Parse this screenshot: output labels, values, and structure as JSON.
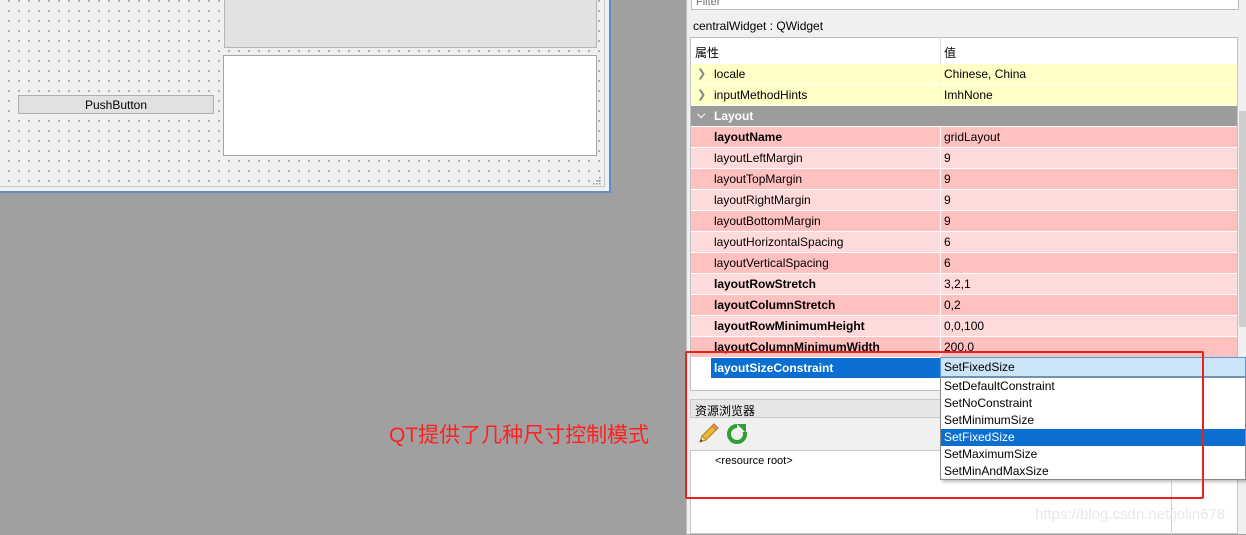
{
  "form": {
    "push_button_label": "PushButton"
  },
  "property_editor": {
    "filter_placeholder": "Filter",
    "object_label": "centralWidget : QWidget",
    "header": {
      "property": "属性",
      "value": "值"
    },
    "rows": [
      {
        "name": "locale",
        "value": "Chinese, China"
      },
      {
        "name": "inputMethodHints",
        "value": "ImhNone"
      },
      {
        "name": "Layout",
        "value": ""
      },
      {
        "name": "layoutName",
        "value": "gridLayout"
      },
      {
        "name": "layoutLeftMargin",
        "value": "9"
      },
      {
        "name": "layoutTopMargin",
        "value": "9"
      },
      {
        "name": "layoutRightMargin",
        "value": "9"
      },
      {
        "name": "layoutBottomMargin",
        "value": "9"
      },
      {
        "name": "layoutHorizontalSpacing",
        "value": "6"
      },
      {
        "name": "layoutVerticalSpacing",
        "value": "6"
      },
      {
        "name": "layoutRowStretch",
        "value": "3,2,1"
      },
      {
        "name": "layoutColumnStretch",
        "value": "0,2"
      },
      {
        "name": "layoutRowMinimumHeight",
        "value": "0,0,100"
      },
      {
        "name": "layoutColumnMinimumWidth",
        "value": "200,0"
      },
      {
        "name": "layoutSizeConstraint",
        "value": ""
      }
    ]
  },
  "combo": {
    "current": "SetFixedSize",
    "options": [
      "SetDefaultConstraint",
      "SetNoConstraint",
      "SetMinimumSize",
      "SetFixedSize",
      "SetMaximumSize",
      "SetMinAndMaxSize"
    ],
    "selected_index": 3
  },
  "resource_browser": {
    "title": "资源浏览器",
    "root_label": "<resource root>",
    "icons": [
      "pencil-icon",
      "reload-icon"
    ]
  },
  "annotation": "QT提供了几种尺寸控制模式",
  "watermark": "https://blog.csdn.net/jolin678",
  "colors": {
    "selection": "#0a6fd1",
    "annotation_red": "#ff2020",
    "row_pink": "#ffc0c0",
    "row_yellow": "#ffffc8"
  }
}
